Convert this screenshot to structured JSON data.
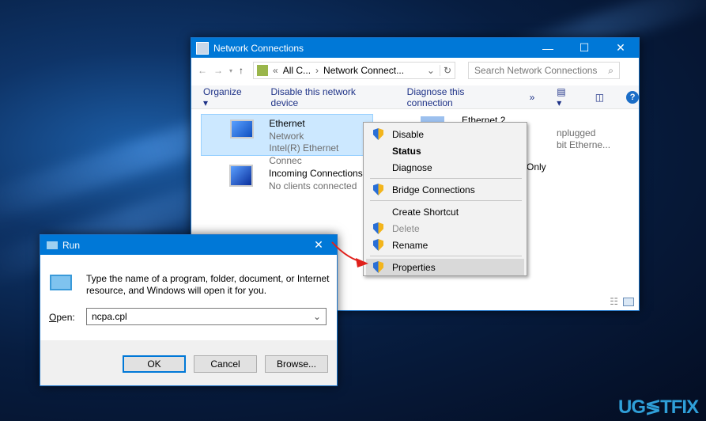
{
  "network_window": {
    "title": "Network Connections",
    "breadcrumb": [
      "All C...",
      "Network Connect..."
    ],
    "breadcrumb_prefix": "«",
    "search_placeholder": "Search Network Connections",
    "toolbar": {
      "organize": "Organize ▾",
      "disable": "Disable this network device",
      "diagnose": "Diagnose this connection",
      "more": "»"
    },
    "connections": [
      {
        "name": "Ethernet",
        "status": "Network",
        "device": "Intel(R) Ethernet Connec"
      },
      {
        "name": "Incoming Connections",
        "status": "No clients connected"
      },
      {
        "name": "Ethernet 2",
        "status": "nplugged",
        "device": "bit Etherne..."
      },
      {
        "status": "Only"
      }
    ]
  },
  "context_menu": {
    "items": [
      {
        "label": "Disable",
        "shield": true
      },
      {
        "label": "Status",
        "bold": true
      },
      {
        "label": "Diagnose"
      },
      {
        "label": "Bridge Connections",
        "shield": true
      },
      {
        "label": "Create Shortcut"
      },
      {
        "label": "Delete",
        "shield": true,
        "disabled": true
      },
      {
        "label": "Rename",
        "shield": true
      },
      {
        "label": "Properties",
        "shield": true,
        "highlighted": true
      }
    ]
  },
  "run_dialog": {
    "title": "Run",
    "description": "Type the name of a program, folder, document, or Internet resource, and Windows will open it for you.",
    "open_label": "Open:",
    "open_value": "ncpa.cpl",
    "ok": "OK",
    "cancel": "Cancel",
    "browse": "Browse..."
  },
  "watermark": {
    "text": "UG≶TFIX"
  },
  "colors": {
    "accent": "#0078d7",
    "arrow": "#e0201b"
  }
}
